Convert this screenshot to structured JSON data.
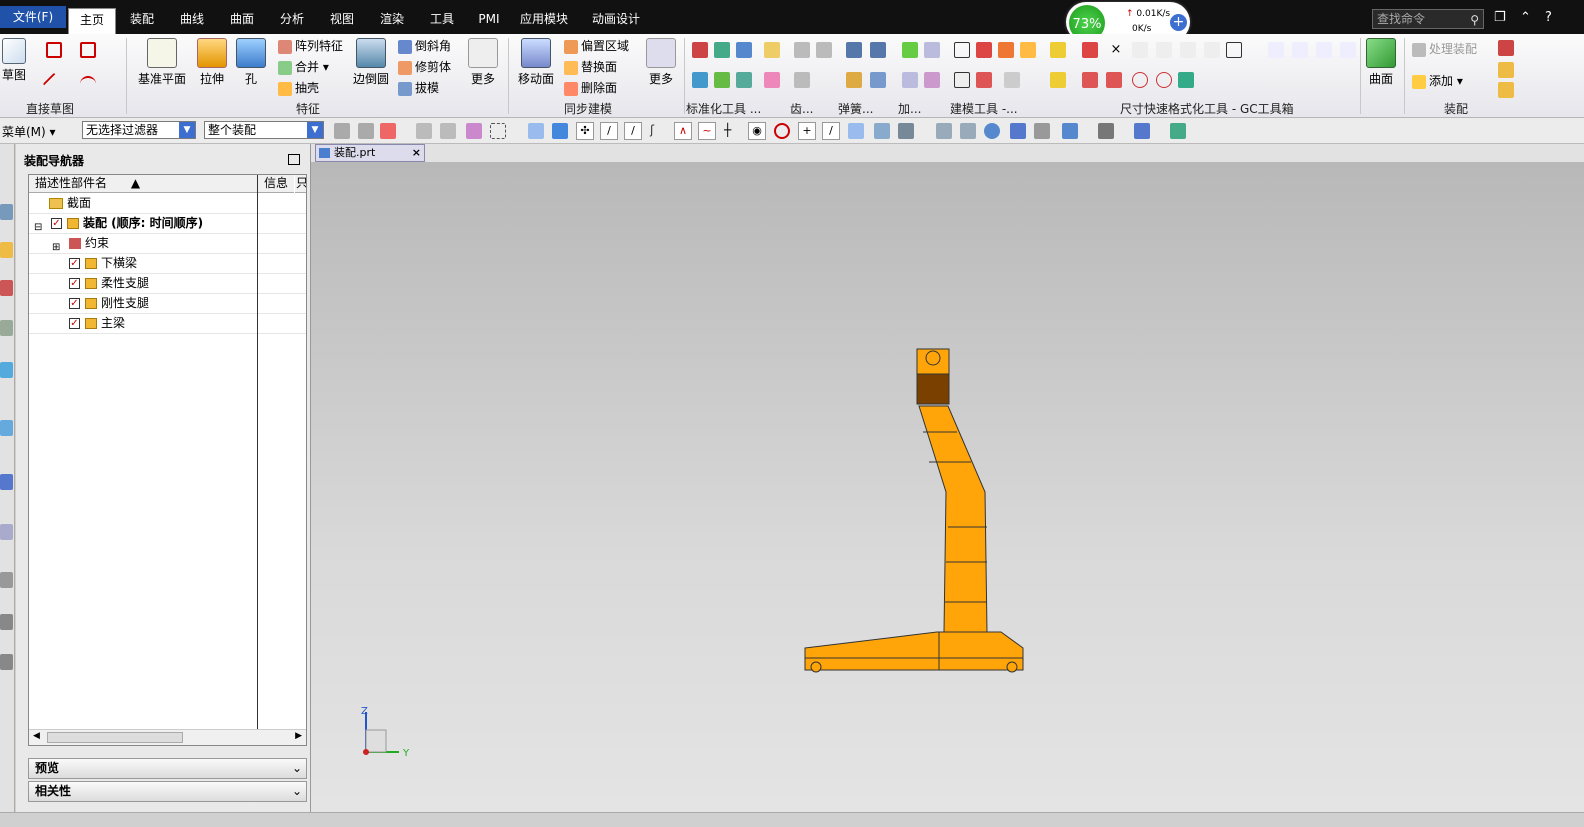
{
  "menubar": {
    "file": "文件(F)",
    "tabs": [
      "主页",
      "装配",
      "曲线",
      "曲面",
      "分析",
      "视图",
      "渲染",
      "工具",
      "PMI",
      "应用模块",
      "动画设计"
    ],
    "active_tab": "主页",
    "search_placeholder": "查找命令"
  },
  "net_widget": {
    "percent": "73%",
    "up": "0.01K/s",
    "down": "0K/s"
  },
  "ribbon": {
    "groups": {
      "direct_sketch": "直接草图",
      "feature": "特征",
      "sync_modeling": "同步建模",
      "std_tools": "标准化工具 ...",
      "gear": "齿...",
      "spring": "弹簧...",
      "add": "加...",
      "build_tools": "建模工具 -...",
      "dim_format": "尺寸快速格式化工具 - GC工具箱",
      "assembly": "装配"
    },
    "buttons": {
      "sketch": "草图",
      "datum_plane": "基准平面",
      "extrude": "拉伸",
      "hole": "孔",
      "pattern_feature": "阵列特征",
      "unite": "合并",
      "shell": "抽壳",
      "edge_blend": "边倒圆",
      "chamfer": "倒斜角",
      "trim_body": "修剪体",
      "draft": "拔模",
      "more1": "更多",
      "move_face": "移动面",
      "offset_region": "偏置区域",
      "replace_face": "替换面",
      "delete_face": "删除面",
      "more2": "更多",
      "surface": "曲面",
      "process_assembly": "处理装配",
      "add_component": "添加"
    }
  },
  "toolbar2": {
    "menu": "菜单(M)",
    "filter": "无选择过滤器",
    "scope": "整个装配"
  },
  "navigator": {
    "title": "装配导航器",
    "columns": [
      "描述性部件名",
      "信息",
      "只"
    ],
    "rows": [
      {
        "label": "截面",
        "indent": 0,
        "check": false
      },
      {
        "label": "装配 (顺序: 时间顺序)",
        "indent": 0,
        "check": true
      },
      {
        "label": "约束",
        "indent": 1,
        "check": false
      },
      {
        "label": "下横梁",
        "indent": 2,
        "check": true
      },
      {
        "label": "柔性支腿",
        "indent": 2,
        "check": true
      },
      {
        "label": "刚性支腿",
        "indent": 2,
        "check": true
      },
      {
        "label": "主梁",
        "indent": 2,
        "check": true
      }
    ],
    "panels": [
      "预览",
      "相关性"
    ]
  },
  "document_tab": "装配.prt",
  "axes": {
    "z": "Z",
    "y": "Y"
  },
  "colors": {
    "part": "#ffa50a",
    "part_dark": "#7a4000",
    "accent": "#1f52a8"
  }
}
